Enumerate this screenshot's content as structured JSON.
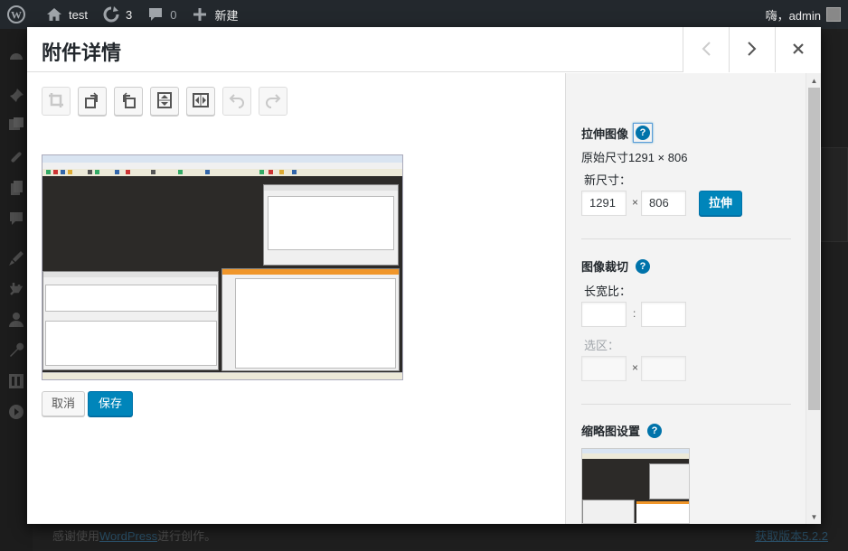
{
  "adminbar": {
    "site_name": "test",
    "updates_count": "3",
    "comments_count": "0",
    "new_label": "新建",
    "greeting": "嗨，admin"
  },
  "footer": {
    "thanks_prefix": "感谢使用",
    "wordpress_link": "WordPress",
    "thanks_suffix": "进行创作。",
    "version_link": "获取版本5.2.2"
  },
  "modal": {
    "title": "附件详情"
  },
  "editor": {
    "toolbar": [
      {
        "name": "crop-icon",
        "state": "disabled"
      },
      {
        "name": "rotate-left-icon",
        "state": "enabled"
      },
      {
        "name": "rotate-right-icon",
        "state": "enabled"
      },
      {
        "name": "flip-vertical-icon",
        "state": "enabled"
      },
      {
        "name": "flip-horizontal-icon",
        "state": "enabled"
      },
      {
        "name": "undo-icon",
        "state": "disabled"
      },
      {
        "name": "redo-icon",
        "state": "disabled"
      }
    ],
    "cancel_label": "取消",
    "save_label": "保存"
  },
  "settings": {
    "scale": {
      "title": "拉伸图像",
      "original_size": "原始尺寸1291 × 806",
      "new_size_label": "新尺寸：",
      "width_value": "1291",
      "height_value": "806",
      "times": "×",
      "button_label": "拉伸"
    },
    "crop": {
      "title": "图像裁切",
      "aspect_label": "长宽比：",
      "aspect_separator": ":",
      "selection_label": "选区：",
      "selection_separator": "×"
    },
    "thumbnail": {
      "title": "缩略图设置"
    },
    "help_glyph": "?"
  },
  "colors": {
    "primary_button": "#0085ba",
    "help_icon": "#0073aa",
    "adminbar": "#23282d"
  }
}
